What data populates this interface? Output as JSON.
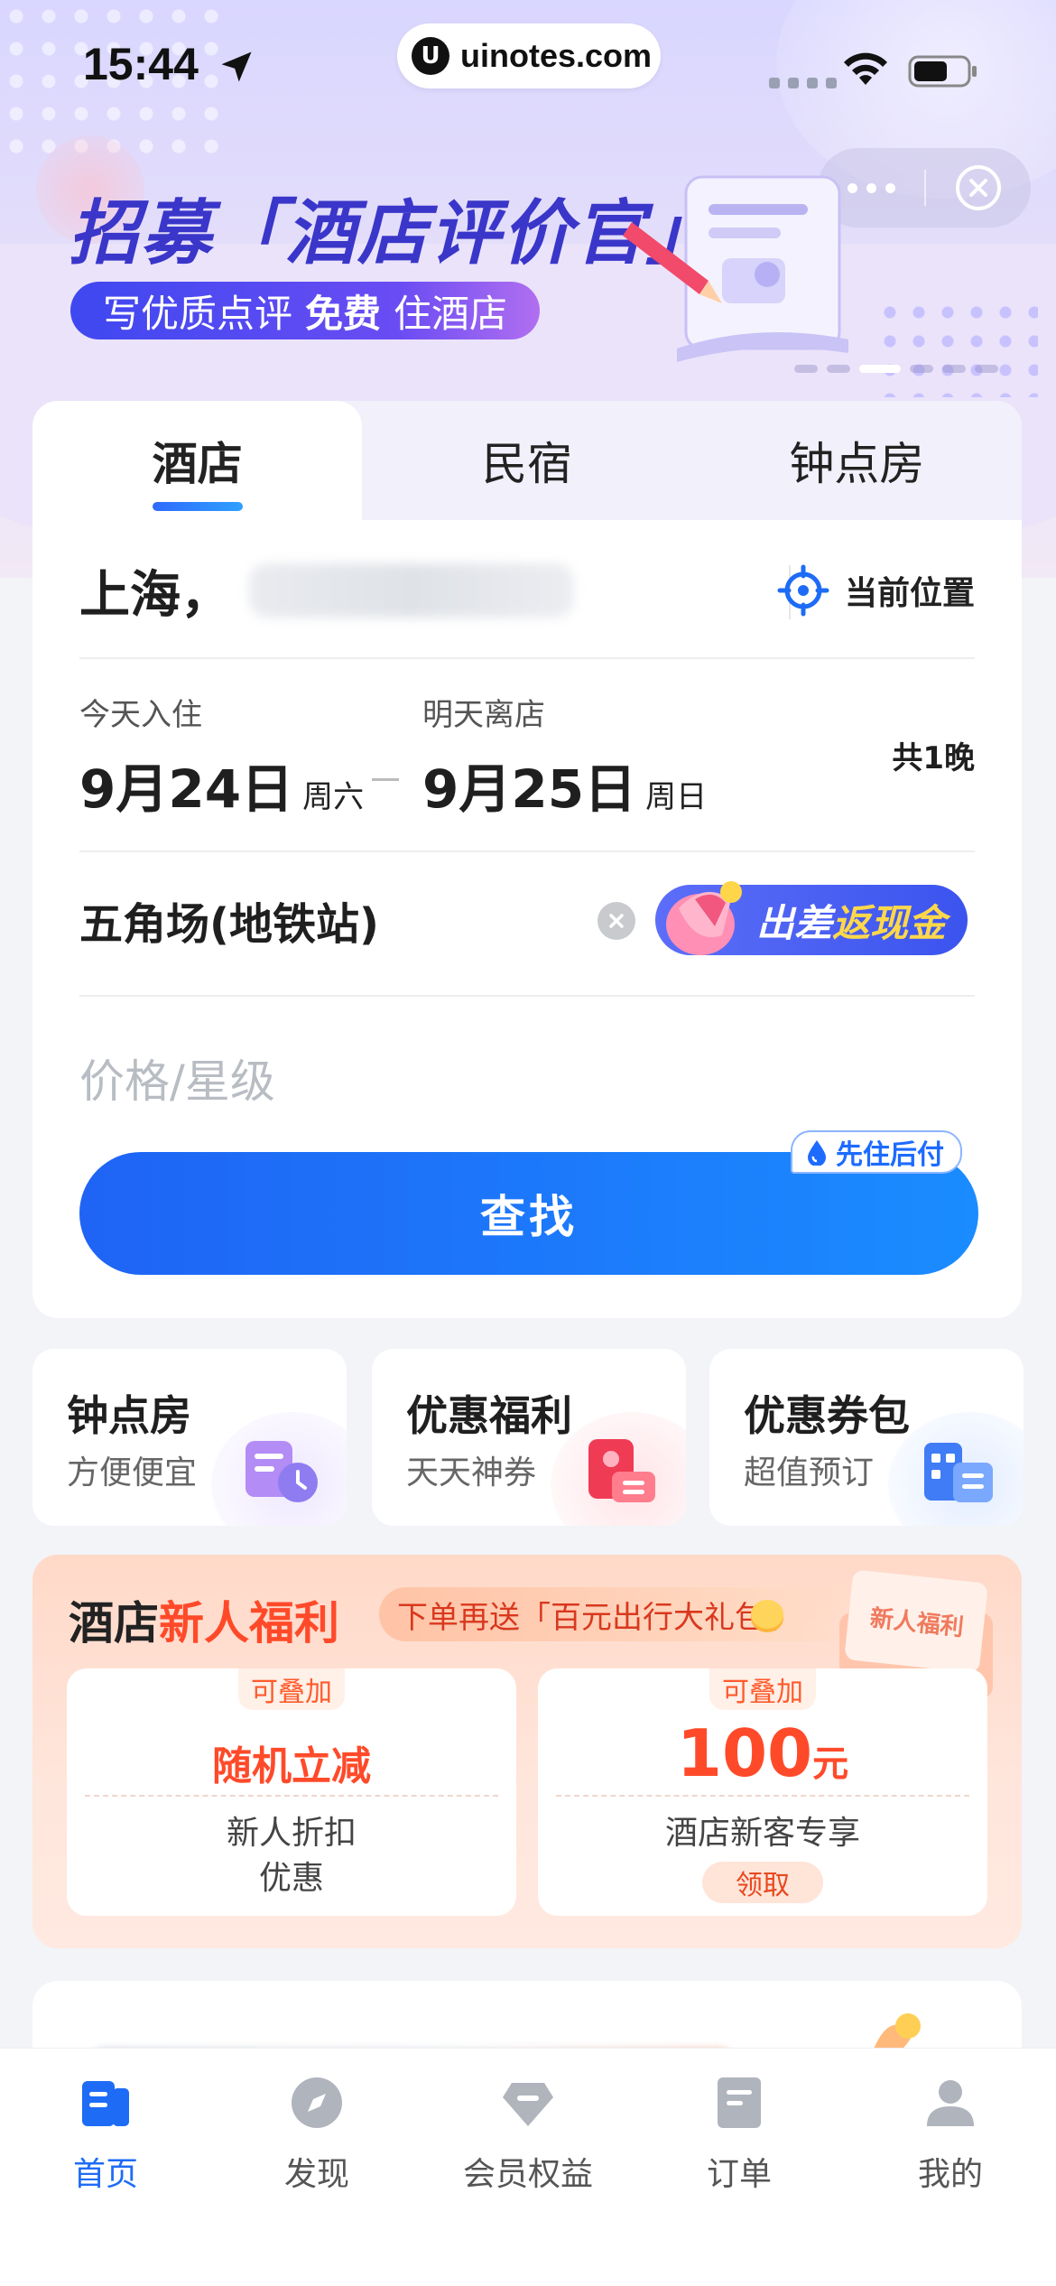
{
  "status_bar": {
    "time": "15:44",
    "url": "uinotes.com",
    "url_logo": "U"
  },
  "banner": {
    "title": "招募「酒店评价官」",
    "subtitle_pre": "写优质点评",
    "subtitle_bold": "免费",
    "subtitle_post": "住酒店",
    "pager_count": 6,
    "pager_active_index": 2
  },
  "search_card": {
    "tabs": [
      {
        "label": "酒店",
        "active": true
      },
      {
        "label": "民宿",
        "active": false
      },
      {
        "label": "钟点房",
        "active": false
      }
    ],
    "city": "上海，",
    "locate_label": "当前位置",
    "checkin": {
      "label": "今天入住",
      "date": "9月24日",
      "weekday": "周六"
    },
    "checkout": {
      "label": "明天离店",
      "date": "9月25日",
      "weekday": "周日"
    },
    "nights": "共1晚",
    "keyword": "五角场(地铁站)",
    "promo_text_white": "出差",
    "promo_text_gold": "返现金",
    "price_placeholder": "价格/星级",
    "pay_tag": "先住后付",
    "search_button": "查找"
  },
  "quick_entries": [
    {
      "title": "钟点房",
      "subtitle": "方便便宜",
      "icon": "clock-room-icon"
    },
    {
      "title": "优惠福利",
      "subtitle": "天天神券",
      "icon": "coupon-card-icon"
    },
    {
      "title": "优惠券包",
      "subtitle": "超值预订",
      "icon": "building-icon"
    }
  ],
  "new_user": {
    "title_pre": "酒店",
    "title_highlight": "新人福利",
    "gift_text": "下单再送「百元出行大礼包」",
    "badge_text": "新人福利",
    "coupons": [
      {
        "tag": "可叠加",
        "main": "随机立减",
        "desc_line1": "新人折扣",
        "desc_line2": "优惠"
      },
      {
        "tag": "可叠加",
        "amount": "100",
        "unit": "元",
        "desc_line1": "酒店新客专享",
        "claim": "领取"
      }
    ]
  },
  "tab_bar": {
    "items": [
      {
        "label": "首页",
        "icon": "home-icon",
        "active": true
      },
      {
        "label": "发现",
        "icon": "compass-icon",
        "active": false
      },
      {
        "label": "会员权益",
        "icon": "diamond-icon",
        "active": false
      },
      {
        "label": "订单",
        "icon": "order-icon",
        "active": false
      },
      {
        "label": "我的",
        "icon": "profile-icon",
        "active": false
      }
    ]
  },
  "colors": {
    "primary": "#1e6cf6",
    "accent_orange": "#ff4a2a",
    "banner_title": "#3a36c9"
  }
}
